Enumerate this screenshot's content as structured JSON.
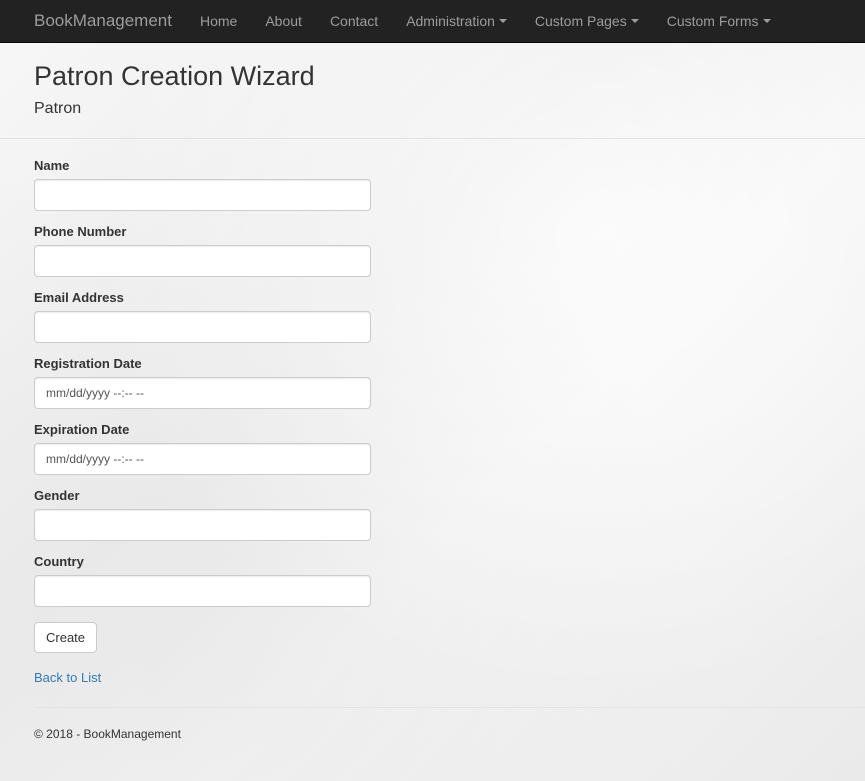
{
  "navbar": {
    "brand": "BookManagement",
    "items": [
      {
        "label": "Home"
      },
      {
        "label": "About"
      },
      {
        "label": "Contact"
      },
      {
        "label": "Administration"
      },
      {
        "label": "Custom Pages"
      },
      {
        "label": "Custom Forms"
      }
    ]
  },
  "page": {
    "title": "Patron Creation Wizard",
    "subtitle": "Patron"
  },
  "form": {
    "name_label": "Name",
    "name_value": "",
    "phone_label": "Phone Number",
    "phone_value": "",
    "email_label": "Email Address",
    "email_value": "",
    "registration_label": "Registration Date",
    "registration_placeholder": "mm/dd/yyyy --:-- --",
    "expiration_label": "Expiration Date",
    "expiration_placeholder": "mm/dd/yyyy --:-- --",
    "gender_label": "Gender",
    "gender_value": "",
    "country_label": "Country",
    "country_value": "",
    "create_label": "Create"
  },
  "back_link": "Back to List",
  "footer": "© 2018 - BookManagement",
  "colors": {
    "navbar_bg": "#222222",
    "navbar_text": "#9d9d9d",
    "link": "#337ab7"
  }
}
